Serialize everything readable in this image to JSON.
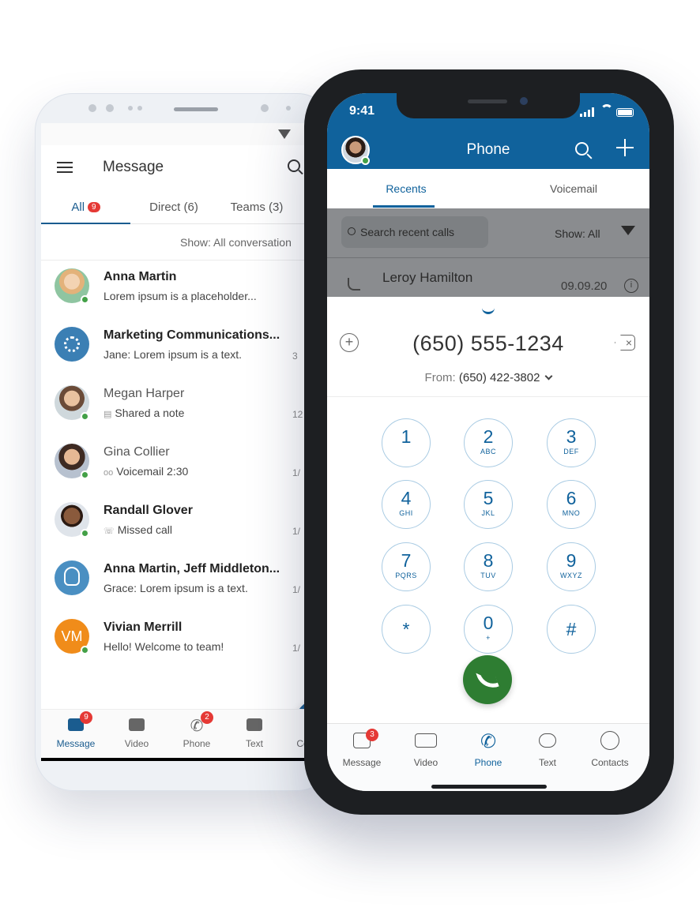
{
  "android": {
    "header": {
      "title": "Message"
    },
    "tabs": [
      {
        "label": "All",
        "badge": "9"
      },
      {
        "label": "Direct (6)"
      },
      {
        "label": "Teams (3)"
      }
    ],
    "filter_label": "Show: All conversation",
    "conversations": [
      {
        "name": "Anna Martin",
        "preview": "Lorem ipsum is a placeholder...",
        "time": "",
        "icon": ""
      },
      {
        "name": "Marketing Communications...",
        "preview": "Jane: Lorem ipsum is a text.",
        "time": "3",
        "icon": ""
      },
      {
        "name": "Megan Harper",
        "preview": "Shared a note",
        "time": "12",
        "icon": "note-icon"
      },
      {
        "name": "Gina Collier",
        "preview": "Voicemail  2:30",
        "time": "1/",
        "icon": "voicemail-icon"
      },
      {
        "name": "Randall Glover",
        "preview": "Missed call",
        "time": "1/",
        "icon": "missed-call-icon"
      },
      {
        "name": "Anna Martin, Jeff Middleton...",
        "preview": "Grace: Lorem ipsum is a text.",
        "time": "1/",
        "icon": ""
      },
      {
        "name": "Vivian Merrill",
        "preview": "Hello! Welcome to team!",
        "time": "1/",
        "icon": "",
        "initials": "VM"
      }
    ],
    "bottom_nav": [
      {
        "label": "Message",
        "badge": "9"
      },
      {
        "label": "Video"
      },
      {
        "label": "Phone",
        "badge": "2"
      },
      {
        "label": "Text"
      },
      {
        "label": "Co"
      }
    ]
  },
  "iphone": {
    "status": {
      "time": "9:41"
    },
    "header": {
      "title": "Phone"
    },
    "tabs": [
      {
        "label": "Recents"
      },
      {
        "label": "Voicemail"
      }
    ],
    "recents": {
      "search_placeholder": "Search recent calls",
      "filter_label": "Show: All",
      "first_entry": {
        "name": "Leroy Hamilton",
        "date": "09.09.20"
      }
    },
    "dialer": {
      "number": "(650) 555-1234",
      "from_label": "From:",
      "from_number": "(650) 422-3802",
      "keys": [
        {
          "digit": "1",
          "letters": ""
        },
        {
          "digit": "2",
          "letters": "ABC"
        },
        {
          "digit": "3",
          "letters": "DEF"
        },
        {
          "digit": "4",
          "letters": "GHI"
        },
        {
          "digit": "5",
          "letters": "JKL"
        },
        {
          "digit": "6",
          "letters": "MNO"
        },
        {
          "digit": "7",
          "letters": "PQRS"
        },
        {
          "digit": "8",
          "letters": "TUV"
        },
        {
          "digit": "9",
          "letters": "WXYZ"
        },
        {
          "digit": "*",
          "letters": ""
        },
        {
          "digit": "0",
          "letters": "+"
        },
        {
          "digit": "#",
          "letters": ""
        }
      ]
    },
    "tab_bar": [
      {
        "label": "Message",
        "badge": "3"
      },
      {
        "label": "Video"
      },
      {
        "label": "Phone"
      },
      {
        "label": "Text"
      },
      {
        "label": "Contacts"
      }
    ]
  },
  "colors": {
    "brand_blue": "#10629c",
    "call_green": "#2e7d32",
    "badge_red": "#e53935",
    "presence_green": "#43a047"
  }
}
